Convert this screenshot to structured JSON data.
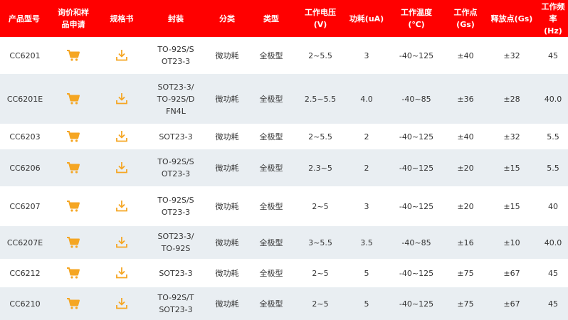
{
  "accent_color": "#ff0000",
  "icon_color": "#f5a623",
  "headers": [
    {
      "line1": "产品型号",
      "line2": ""
    },
    {
      "line1": "询价和样",
      "line2": "品申请"
    },
    {
      "line1": "规格书",
      "line2": ""
    },
    {
      "line1": "封装",
      "line2": ""
    },
    {
      "line1": "分类",
      "line2": ""
    },
    {
      "line1": "类型",
      "line2": ""
    },
    {
      "line1": "工作电压",
      "line2": "(V)"
    },
    {
      "line1": "功耗(uA)",
      "line2": ""
    },
    {
      "line1": "工作温度",
      "line2": "(℃)"
    },
    {
      "line1": "工作点(Gs)",
      "line2": ""
    },
    {
      "line1": "释放点(Gs)",
      "line2": ""
    },
    {
      "line1": "工作频率",
      "line2": "(Hz)"
    }
  ],
  "rows": [
    {
      "model": "CC6201",
      "package_l1": "TO-92S/S",
      "package_l2": "OT23-3",
      "package_l3": "",
      "category": "微功耗",
      "type": "全极型",
      "voltage": "2~5.5",
      "power": "3",
      "temp": "-40~125",
      "bop": "±40",
      "brp": "±32",
      "freq": "45"
    },
    {
      "model": "CC6201E",
      "package_l1": "SOT23-3/",
      "package_l2": "TO-92S/D",
      "package_l3": "FN4L",
      "category": "微功耗",
      "type": "全极型",
      "voltage": "2.5~5.5",
      "power": "4.0",
      "temp": "-40~85",
      "bop": "±36",
      "brp": "±28",
      "freq": "40.0"
    },
    {
      "model": "CC6203",
      "package_l1": "SOT23-3",
      "package_l2": "",
      "package_l3": "",
      "category": "微功耗",
      "type": "全极型",
      "voltage": "2~5.5",
      "power": "2",
      "temp": "-40~125",
      "bop": "±40",
      "brp": "±32",
      "freq": "5.5"
    },
    {
      "model": "CC6206",
      "package_l1": "TO-92S/S",
      "package_l2": "OT23-3",
      "package_l3": "",
      "category": "微功耗",
      "type": "全极型",
      "voltage": "2.3~5",
      "power": "2",
      "temp": "-40~125",
      "bop": "±20",
      "brp": "±15",
      "freq": "5.5"
    },
    {
      "model": "CC6207",
      "package_l1": "TO-92S/S",
      "package_l2": "OT23-3",
      "package_l3": "",
      "category": "微功耗",
      "type": "全极型",
      "voltage": "2~5",
      "power": "3",
      "temp": "-40~125",
      "bop": "±20",
      "brp": "±15",
      "freq": "40"
    },
    {
      "model": "CC6207E",
      "package_l1": "SOT23-3/",
      "package_l2": "TO-92S",
      "package_l3": "",
      "category": "微功耗",
      "type": "全极型",
      "voltage": "3~5.5",
      "power": "3.5",
      "temp": "-40~85",
      "bop": "±16",
      "brp": "±10",
      "freq": "40.0"
    },
    {
      "model": "CC6212",
      "package_l1": "SOT23-3",
      "package_l2": "",
      "package_l3": "",
      "category": "微功耗",
      "type": "全极型",
      "voltage": "2~5",
      "power": "5",
      "temp": "-40~125",
      "bop": "±75",
      "brp": "±67",
      "freq": "45"
    },
    {
      "model": "CC6210",
      "package_l1": "TO-92S/T",
      "package_l2": "SOT23-3",
      "package_l3": "",
      "category": "微功耗",
      "type": "全极型",
      "voltage": "2~5",
      "power": "5",
      "temp": "-40~125",
      "bop": "±75",
      "brp": "±67",
      "freq": "45"
    }
  ],
  "icons": {
    "inquiry": "shopping-cart-icon",
    "datasheet": "download-icon"
  }
}
